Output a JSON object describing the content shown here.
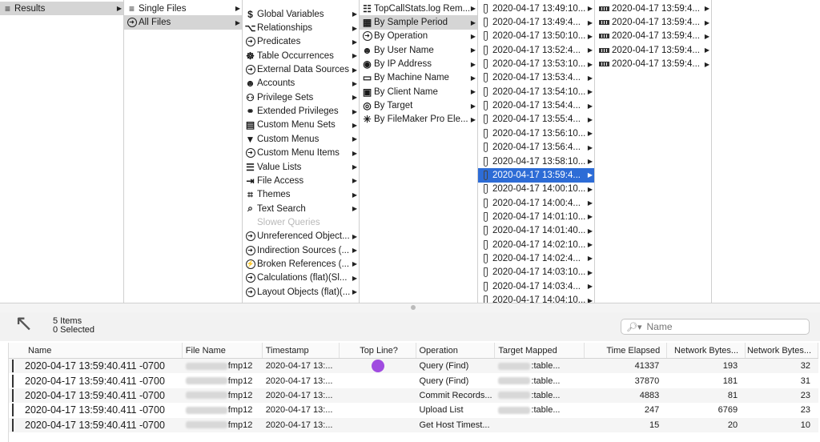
{
  "columns": {
    "col1": [
      {
        "label": "Results",
        "icon": "layers-icon",
        "arrow": true,
        "state": "sel"
      }
    ],
    "col2": [
      {
        "label": "Single Files",
        "icon": "layers-icon",
        "arrow": true
      },
      {
        "label": "All Files",
        "icon": "circle-arrow-icon",
        "arrow": true,
        "state": "sel"
      }
    ],
    "col3": [
      {
        "label": "Global Variables",
        "icon": "dollar-icon",
        "arrow": true
      },
      {
        "label": "Relationships",
        "icon": "share-icon",
        "arrow": true
      },
      {
        "label": "Predicates",
        "icon": "circle-arrow-icon",
        "arrow": true
      },
      {
        "label": "Table Occurrences",
        "icon": "database-icon",
        "arrow": true
      },
      {
        "label": "External Data Sources",
        "icon": "circle-arrow-icon",
        "arrow": true
      },
      {
        "label": "Accounts",
        "icon": "person-icon",
        "arrow": true
      },
      {
        "label": "Privilege Sets",
        "icon": "people-icon",
        "arrow": true
      },
      {
        "label": "Extended Privileges",
        "icon": "link-icon",
        "arrow": true
      },
      {
        "label": "Custom Menu Sets",
        "icon": "menu-icon",
        "arrow": true
      },
      {
        "label": "Custom Menus",
        "icon": "triangle-icon",
        "arrow": true
      },
      {
        "label": "Custom Menu Items",
        "icon": "circle-arrow-icon",
        "arrow": true
      },
      {
        "label": "Value Lists",
        "icon": "list-icon",
        "arrow": true
      },
      {
        "label": "File Access",
        "icon": "file-access-icon",
        "arrow": true
      },
      {
        "label": "Themes",
        "icon": "theme-icon",
        "arrow": true
      },
      {
        "label": "Text Search",
        "icon": "search-icon",
        "arrow": true
      },
      {
        "label": "Slower Queries",
        "icon": "",
        "arrow": false,
        "state": "dim"
      },
      {
        "label": "Unreferenced Object...",
        "icon": "circle-arrow-icon",
        "arrow": true
      },
      {
        "label": "Indirection Sources (...",
        "icon": "circle-arrow-icon",
        "arrow": true
      },
      {
        "label": "Broken References (...",
        "icon": "circle-bolt-icon",
        "arrow": true
      },
      {
        "label": "Calculations (flat)(Sl...",
        "icon": "circle-arrow-icon",
        "arrow": true
      },
      {
        "label": "Layout Objects (flat)(...",
        "icon": "circle-arrow-icon",
        "arrow": true
      }
    ],
    "col4": [
      {
        "label": "TopCallStats.log Rem...",
        "icon": "document-icon",
        "arrow": true
      },
      {
        "label": "By Sample Period",
        "icon": "calendar-icon",
        "arrow": true,
        "state": "sel"
      },
      {
        "label": "By Operation",
        "icon": "circle-arrow-icon",
        "arrow": true
      },
      {
        "label": "By User Name",
        "icon": "person-icon",
        "arrow": true
      },
      {
        "label": "By IP Address",
        "icon": "ip-icon",
        "arrow": true
      },
      {
        "label": "By Machine Name",
        "icon": "machine-icon",
        "arrow": true
      },
      {
        "label": "By Client Name",
        "icon": "client-icon",
        "arrow": true
      },
      {
        "label": "By Target",
        "icon": "target-icon",
        "arrow": true
      },
      {
        "label": "By FileMaker Pro Ele...",
        "icon": "network-icon",
        "arrow": true
      }
    ],
    "col5": [
      {
        "label": "2020-04-17 13:49:10...",
        "icon": "tube-icon",
        "arrow": true
      },
      {
        "label": "2020-04-17 13:49:4...",
        "icon": "tube-icon",
        "arrow": true
      },
      {
        "label": "2020-04-17 13:50:10...",
        "icon": "tube-icon",
        "arrow": true
      },
      {
        "label": "2020-04-17 13:52:4...",
        "icon": "tube-icon",
        "arrow": true
      },
      {
        "label": "2020-04-17 13:53:10...",
        "icon": "tube-icon",
        "arrow": true
      },
      {
        "label": "2020-04-17 13:53:4...",
        "icon": "tube-icon",
        "arrow": true
      },
      {
        "label": "2020-04-17 13:54:10...",
        "icon": "tube-icon",
        "arrow": true
      },
      {
        "label": "2020-04-17 13:54:4...",
        "icon": "tube-icon",
        "arrow": true
      },
      {
        "label": "2020-04-17 13:55:4...",
        "icon": "tube-icon",
        "arrow": true
      },
      {
        "label": "2020-04-17 13:56:10...",
        "icon": "tube-icon",
        "arrow": true
      },
      {
        "label": "2020-04-17 13:56:4...",
        "icon": "tube-icon",
        "arrow": true
      },
      {
        "label": "2020-04-17 13:58:10...",
        "icon": "tube-icon",
        "arrow": true
      },
      {
        "label": "2020-04-17 13:59:4...",
        "icon": "tube-icon",
        "arrow": true,
        "state": "selblue"
      },
      {
        "label": "2020-04-17 14:00:10...",
        "icon": "tube-icon",
        "arrow": true
      },
      {
        "label": "2020-04-17 14:00:4...",
        "icon": "tube-icon",
        "arrow": true
      },
      {
        "label": "2020-04-17 14:01:10...",
        "icon": "tube-icon",
        "arrow": true
      },
      {
        "label": "2020-04-17 14:01:40...",
        "icon": "tube-icon",
        "arrow": true
      },
      {
        "label": "2020-04-17 14:02:10...",
        "icon": "tube-icon",
        "arrow": true
      },
      {
        "label": "2020-04-17 14:02:4...",
        "icon": "tube-icon",
        "arrow": true
      },
      {
        "label": "2020-04-17 14:03:10...",
        "icon": "tube-icon",
        "arrow": true
      },
      {
        "label": "2020-04-17 14:03:4...",
        "icon": "tube-icon",
        "arrow": true
      },
      {
        "label": "2020-04-17 14:04:10...",
        "icon": "tube-icon",
        "arrow": true
      }
    ],
    "col6": [
      {
        "label": "2020-04-17 13:59:4...",
        "icon": "record-icon",
        "arrow": true
      },
      {
        "label": "2020-04-17 13:59:4...",
        "icon": "record-icon",
        "arrow": true
      },
      {
        "label": "2020-04-17 13:59:4...",
        "icon": "record-icon",
        "arrow": true
      },
      {
        "label": "2020-04-17 13:59:4...",
        "icon": "record-icon",
        "arrow": true
      },
      {
        "label": "2020-04-17 13:59:4...",
        "icon": "record-icon",
        "arrow": true
      }
    ]
  },
  "status": {
    "items_count": "5 Items",
    "selected_count": "0 Selected"
  },
  "search": {
    "placeholder": "Name"
  },
  "table": {
    "headers": [
      "Name",
      "File Name",
      "Timestamp",
      "Top Line?",
      "Operation",
      "Target Mapped",
      "Time Elapsed",
      "Network Bytes...",
      "Network Bytes..."
    ],
    "rows": [
      {
        "name": "2020-04-17 13:59:40.411 -0700",
        "file": "fmp12",
        "timestamp": "2020-04-17 13:...",
        "topline": true,
        "operation": "Query (Find)",
        "target": ":table...",
        "elapsed": "41337",
        "bytes_in": "193",
        "bytes_out": "32"
      },
      {
        "name": "2020-04-17 13:59:40.411 -0700",
        "file": "fmp12",
        "timestamp": "2020-04-17 13:...",
        "topline": false,
        "operation": "Query (Find)",
        "target": ":table...",
        "elapsed": "37870",
        "bytes_in": "181",
        "bytes_out": "31"
      },
      {
        "name": "2020-04-17 13:59:40.411 -0700",
        "file": "fmp12",
        "timestamp": "2020-04-17 13:...",
        "topline": false,
        "operation": "Commit Records...",
        "target": ":table...",
        "elapsed": "4883",
        "bytes_in": "81",
        "bytes_out": "23"
      },
      {
        "name": "2020-04-17 13:59:40.411 -0700",
        "file": "fmp12",
        "timestamp": "2020-04-17 13:...",
        "topline": false,
        "operation": "Upload List",
        "target": ":table...",
        "elapsed": "247",
        "bytes_in": "6769",
        "bytes_out": "23"
      },
      {
        "name": "2020-04-17 13:59:40.411 -0700",
        "file": "fmp12",
        "timestamp": "2020-04-17 13:...",
        "topline": false,
        "operation": "Get Host Timest...",
        "target": "",
        "elapsed": "15",
        "bytes_in": "20",
        "bytes_out": "10"
      }
    ]
  },
  "colors": {
    "selection_blue": "#2d6cd6",
    "selection_gray": "#d5d5d5",
    "topline_dot": "#a04be0"
  }
}
